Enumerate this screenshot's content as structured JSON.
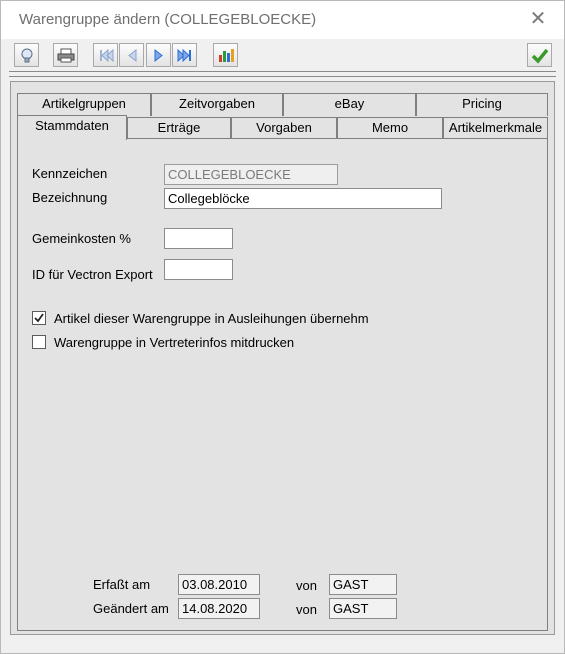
{
  "window": {
    "title": "Warengruppe ändern (COLLEGEBLOECKE)",
    "close_glyph": "✕"
  },
  "toolbar": {
    "icons": [
      "hint-icon",
      "print-icon",
      "first-record-icon",
      "prev-record-icon",
      "next-record-icon",
      "last-record-icon",
      "statistics-icon",
      "confirm-icon"
    ]
  },
  "tabs": {
    "row1": [
      "Artikelgruppen",
      "Zeitvorgaben",
      "eBay",
      "Pricing"
    ],
    "row2": [
      "Stammdaten",
      "Erträge",
      "Vorgaben",
      "Memo",
      "Artikelmerkmale"
    ],
    "active": "Stammdaten"
  },
  "form": {
    "kennzeichen_label": "Kennzeichen",
    "kennzeichen_value": "COLLEGEBLOECKE",
    "bezeichnung_label": "Bezeichnung",
    "bezeichnung_value": "Collegeblöcke",
    "gemeinkosten_label": "Gemeinkosten %",
    "gemeinkosten_value": "",
    "vectron_label": "ID für Vectron Export",
    "vectron_value": "",
    "checkbox1_label": "Artikel dieser Warengruppe in Ausleihungen übernehm",
    "checkbox1_checked": true,
    "checkbox2_label": "Warengruppe in Vertreterinfos mitdrucken",
    "checkbox2_checked": false
  },
  "footer": {
    "erfasst_label": "Erfaßt am",
    "erfasst_date": "03.08.2010",
    "erfasst_von_label": "von",
    "erfasst_von": "GAST",
    "geaendert_label": "Geändert am",
    "geaendert_date": "14.08.2020",
    "geaendert_von_label": "von",
    "geaendert_von": "GAST"
  },
  "colors": {
    "accent_blue": "#2a6fd6",
    "confirm_green": "#3a9a2a",
    "panel_bg": "#e3e3e3"
  }
}
